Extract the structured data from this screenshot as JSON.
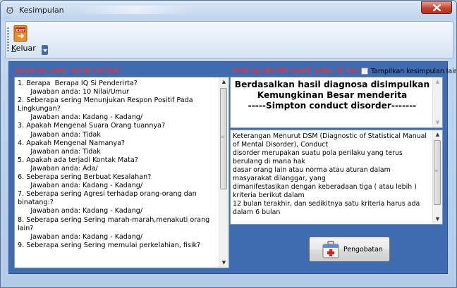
{
  "window": {
    "title": "Kesimpulan"
  },
  "toolbar": {
    "exit_label_mnemonic": "K",
    "exit_label_rest": "eluar",
    "exit_icon_text": "EXIT"
  },
  "answers": {
    "label": "Jawaban yang anda berikan",
    "text": "1. Berapa  Berapa IQ Si Penderirta?\n      Jawaban anda: 10 Nilai/Umur\n2. Seberapa sering Menunjukan Respon Positif Pada Lingkungan?\n      Jawaban anda: Kadang - Kadang/\n3. Apakah Mengenal Suara Orang tuannya?\n      Jawaban anda: Tidak\n4. Apakah Mengenal Namanya?\n      Jawaban anda: Tidak\n5. Apakah ada terjadi Kontak Mata?\n      Jawaban anda: Ada/\n6. Seberapa sering Berbuat Kesalahan?\n      Jawaban anda: Kadang - Kadang/\n7. Seberapa sering Agresi terhadap orang-orang dan binatang:?\n      Jawaban anda: Kadang - Kadang/\n8. Seberapa sering Sering marah-marah,menakuti orang lain?\n      Jawaban anda: Kadang - Kadang/\n9. Seberapa sering Sering memulai perkelahian, fisik?"
  },
  "conclusion": {
    "label": "Kesimpulan Penyakit yang di derita",
    "checkbox_label": "Tampilkan kesimpulan lain",
    "checkbox_checked": false,
    "line1": "Berdasalkan hasil diagnosa disimpulkan",
    "line2": "Kemungkinan Besar menderita",
    "line3": "-----Simpton conduct disorder-------"
  },
  "description": {
    "text": "Keterangan Menurut DSM (Diagnostic of Statistical Manual of Mental Disorder), Conduct\ndisorder merupakan suatu pola perilaku yang terus berulang di mana hak\ndasar orang lain atau norma atau aturan dalam masyarakat dilanggar, yang\ndimanifestasikan dengan keberadaan tiga ( atau lebih ) kriteria berikut dalam\n12 bulan terakhir, dan sedikitnya satu kriteria harus ada dalam 6 bulan"
  },
  "buttons": {
    "pengobatan_label": "Pengobatan"
  },
  "icons": {
    "window": "stethoscope-icon",
    "exit": "exit-door-icon",
    "pengobatan": "medicine-kit-icon",
    "close": "close-icon"
  },
  "colors": {
    "panel_bg": "#3f6bb0",
    "label_red": "#ff2a2a",
    "close_red": "#c4432e"
  }
}
